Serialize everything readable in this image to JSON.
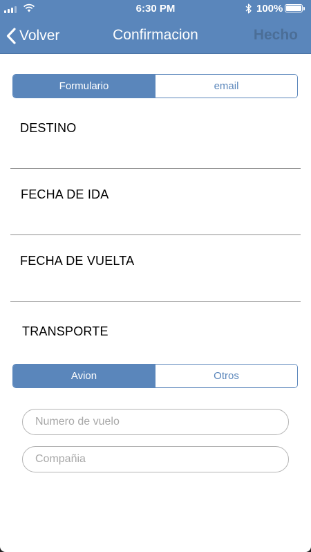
{
  "status_bar": {
    "time": "6:30 PM",
    "battery_percent": "100%",
    "battery_level": 1.0
  },
  "nav": {
    "back_label": "Volver",
    "title": "Confirmacion",
    "done_label": "Hecho"
  },
  "mode_tabs": {
    "options": [
      "Formulario",
      "email"
    ],
    "selected": "Formulario"
  },
  "fields": {
    "destino_label": "DESTINO",
    "fecha_ida_label": "FECHA DE IDA",
    "fecha_vuelta_label": "FECHA DE VUELTA",
    "transporte_label": "TRANSPORTE"
  },
  "transport_tabs": {
    "options": [
      "Avion",
      "Otros"
    ],
    "selected": "Avion"
  },
  "inputs": {
    "flight_number": {
      "placeholder": "Numero de vuelo",
      "value": ""
    },
    "company": {
      "placeholder": "Compañia",
      "value": ""
    }
  },
  "colors": {
    "accent": "#5a86bb",
    "done_disabled": "#46668c",
    "separator": "#8e8e8e"
  },
  "icons": [
    "signal-icon",
    "wifi-icon",
    "bluetooth-icon",
    "battery-icon",
    "chevron-left-icon"
  ]
}
